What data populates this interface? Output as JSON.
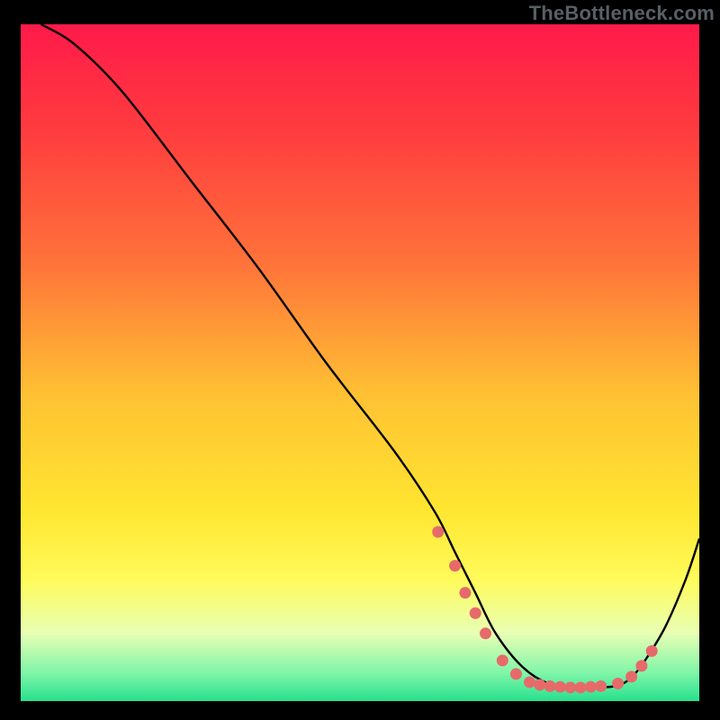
{
  "watermark": "TheBottleneck.com",
  "chart_data": {
    "type": "line",
    "title": "",
    "xlabel": "",
    "ylabel": "",
    "xlim": [
      0,
      100
    ],
    "ylim": [
      0,
      100
    ],
    "grid": false,
    "gradient_stops": [
      {
        "offset": 0.0,
        "color": "#ff1a4a"
      },
      {
        "offset": 0.15,
        "color": "#ff3a3f"
      },
      {
        "offset": 0.35,
        "color": "#ff723a"
      },
      {
        "offset": 0.55,
        "color": "#ffc233"
      },
      {
        "offset": 0.72,
        "color": "#ffe631"
      },
      {
        "offset": 0.82,
        "color": "#fffb5a"
      },
      {
        "offset": 0.9,
        "color": "#e8ffb4"
      },
      {
        "offset": 0.96,
        "color": "#7cf5a8"
      },
      {
        "offset": 1.0,
        "color": "#27e08d"
      }
    ],
    "series": [
      {
        "name": "bottleneck-curve",
        "x": [
          3,
          8,
          15,
          25,
          35,
          45,
          55,
          61,
          64,
          67,
          70,
          74,
          78,
          82,
          85,
          88,
          90,
          92,
          95,
          98,
          100
        ],
        "y": [
          100,
          97,
          90,
          77,
          64,
          50,
          37,
          28,
          22,
          16,
          10,
          5,
          2.5,
          2,
          2,
          2.3,
          3.5,
          6,
          11,
          18,
          24
        ]
      }
    ],
    "markers": {
      "name": "dots",
      "color": "#e66a6a",
      "x": [
        61.5,
        64,
        65.5,
        67,
        68.5,
        71,
        73,
        75,
        76.5,
        78,
        79.5,
        81,
        82.5,
        84,
        85.5,
        88,
        90,
        91.5,
        93
      ],
      "y": [
        25,
        20,
        16,
        13,
        10,
        6,
        4,
        2.8,
        2.4,
        2.2,
        2.1,
        2,
        2,
        2.1,
        2.2,
        2.6,
        3.6,
        5.2,
        7.4
      ]
    }
  }
}
